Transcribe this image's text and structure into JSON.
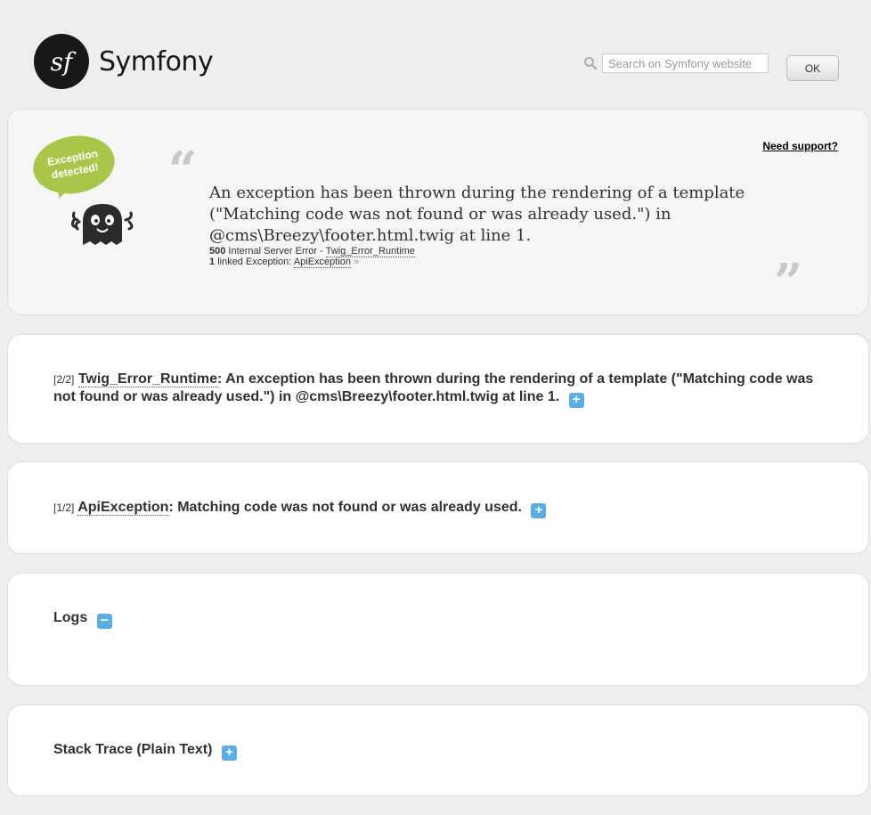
{
  "header": {
    "logo_glyph": "sf",
    "brand": "Symfony",
    "search_placeholder": "Search on Symfony website",
    "ok_label": "OK"
  },
  "error_block": {
    "badge_text": "Exception detected!",
    "need_support": "Need support?",
    "message": "An exception has been thrown during the rendering of a template (\"Matching code was not found or was already used.\") in @cms\\Breezy\\footer.html.twig at line 1.",
    "status_code": "500",
    "status_text": "Internal Server Error -",
    "status_class": "Twig_Error_Runtime",
    "linked_count": "1",
    "linked_text": "linked Exception:",
    "linked_class": "ApiException",
    "linked_arrow": "»"
  },
  "exceptions": [
    {
      "index": "[2/2]",
      "class": "Twig_Error_Runtime",
      "message": ": An exception has been thrown during the rendering of a template (\"Matching code was not found or was already used.\") in @cms\\Breezy\\footer.html.twig at line 1."
    },
    {
      "index": "[1/2]",
      "class": "ApiException",
      "message": ": Matching code was not found or was already used."
    }
  ],
  "logs": {
    "title": "Logs",
    "toggle": "−"
  },
  "stack_trace": {
    "title": "Stack Trace (Plain Text)",
    "toggle": "+"
  },
  "colors": {
    "accent_green": "#a8c74a",
    "toggle_blue": "#5aaee4",
    "background": "#eeeeee"
  }
}
